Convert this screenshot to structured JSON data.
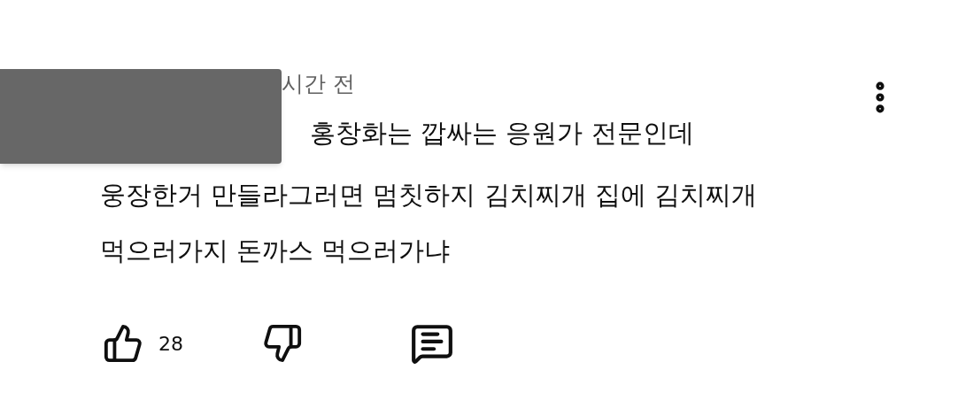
{
  "comment": {
    "time": "시간 전",
    "lines": [
      "홍창화는 깝싸는 응원가 전문인데",
      "웅장한거 만들라그러면 멈칫하지 김치찌개 집에 김치찌개",
      "먹으러가지 돈까스 먹으러가냐"
    ],
    "likes": "28"
  }
}
